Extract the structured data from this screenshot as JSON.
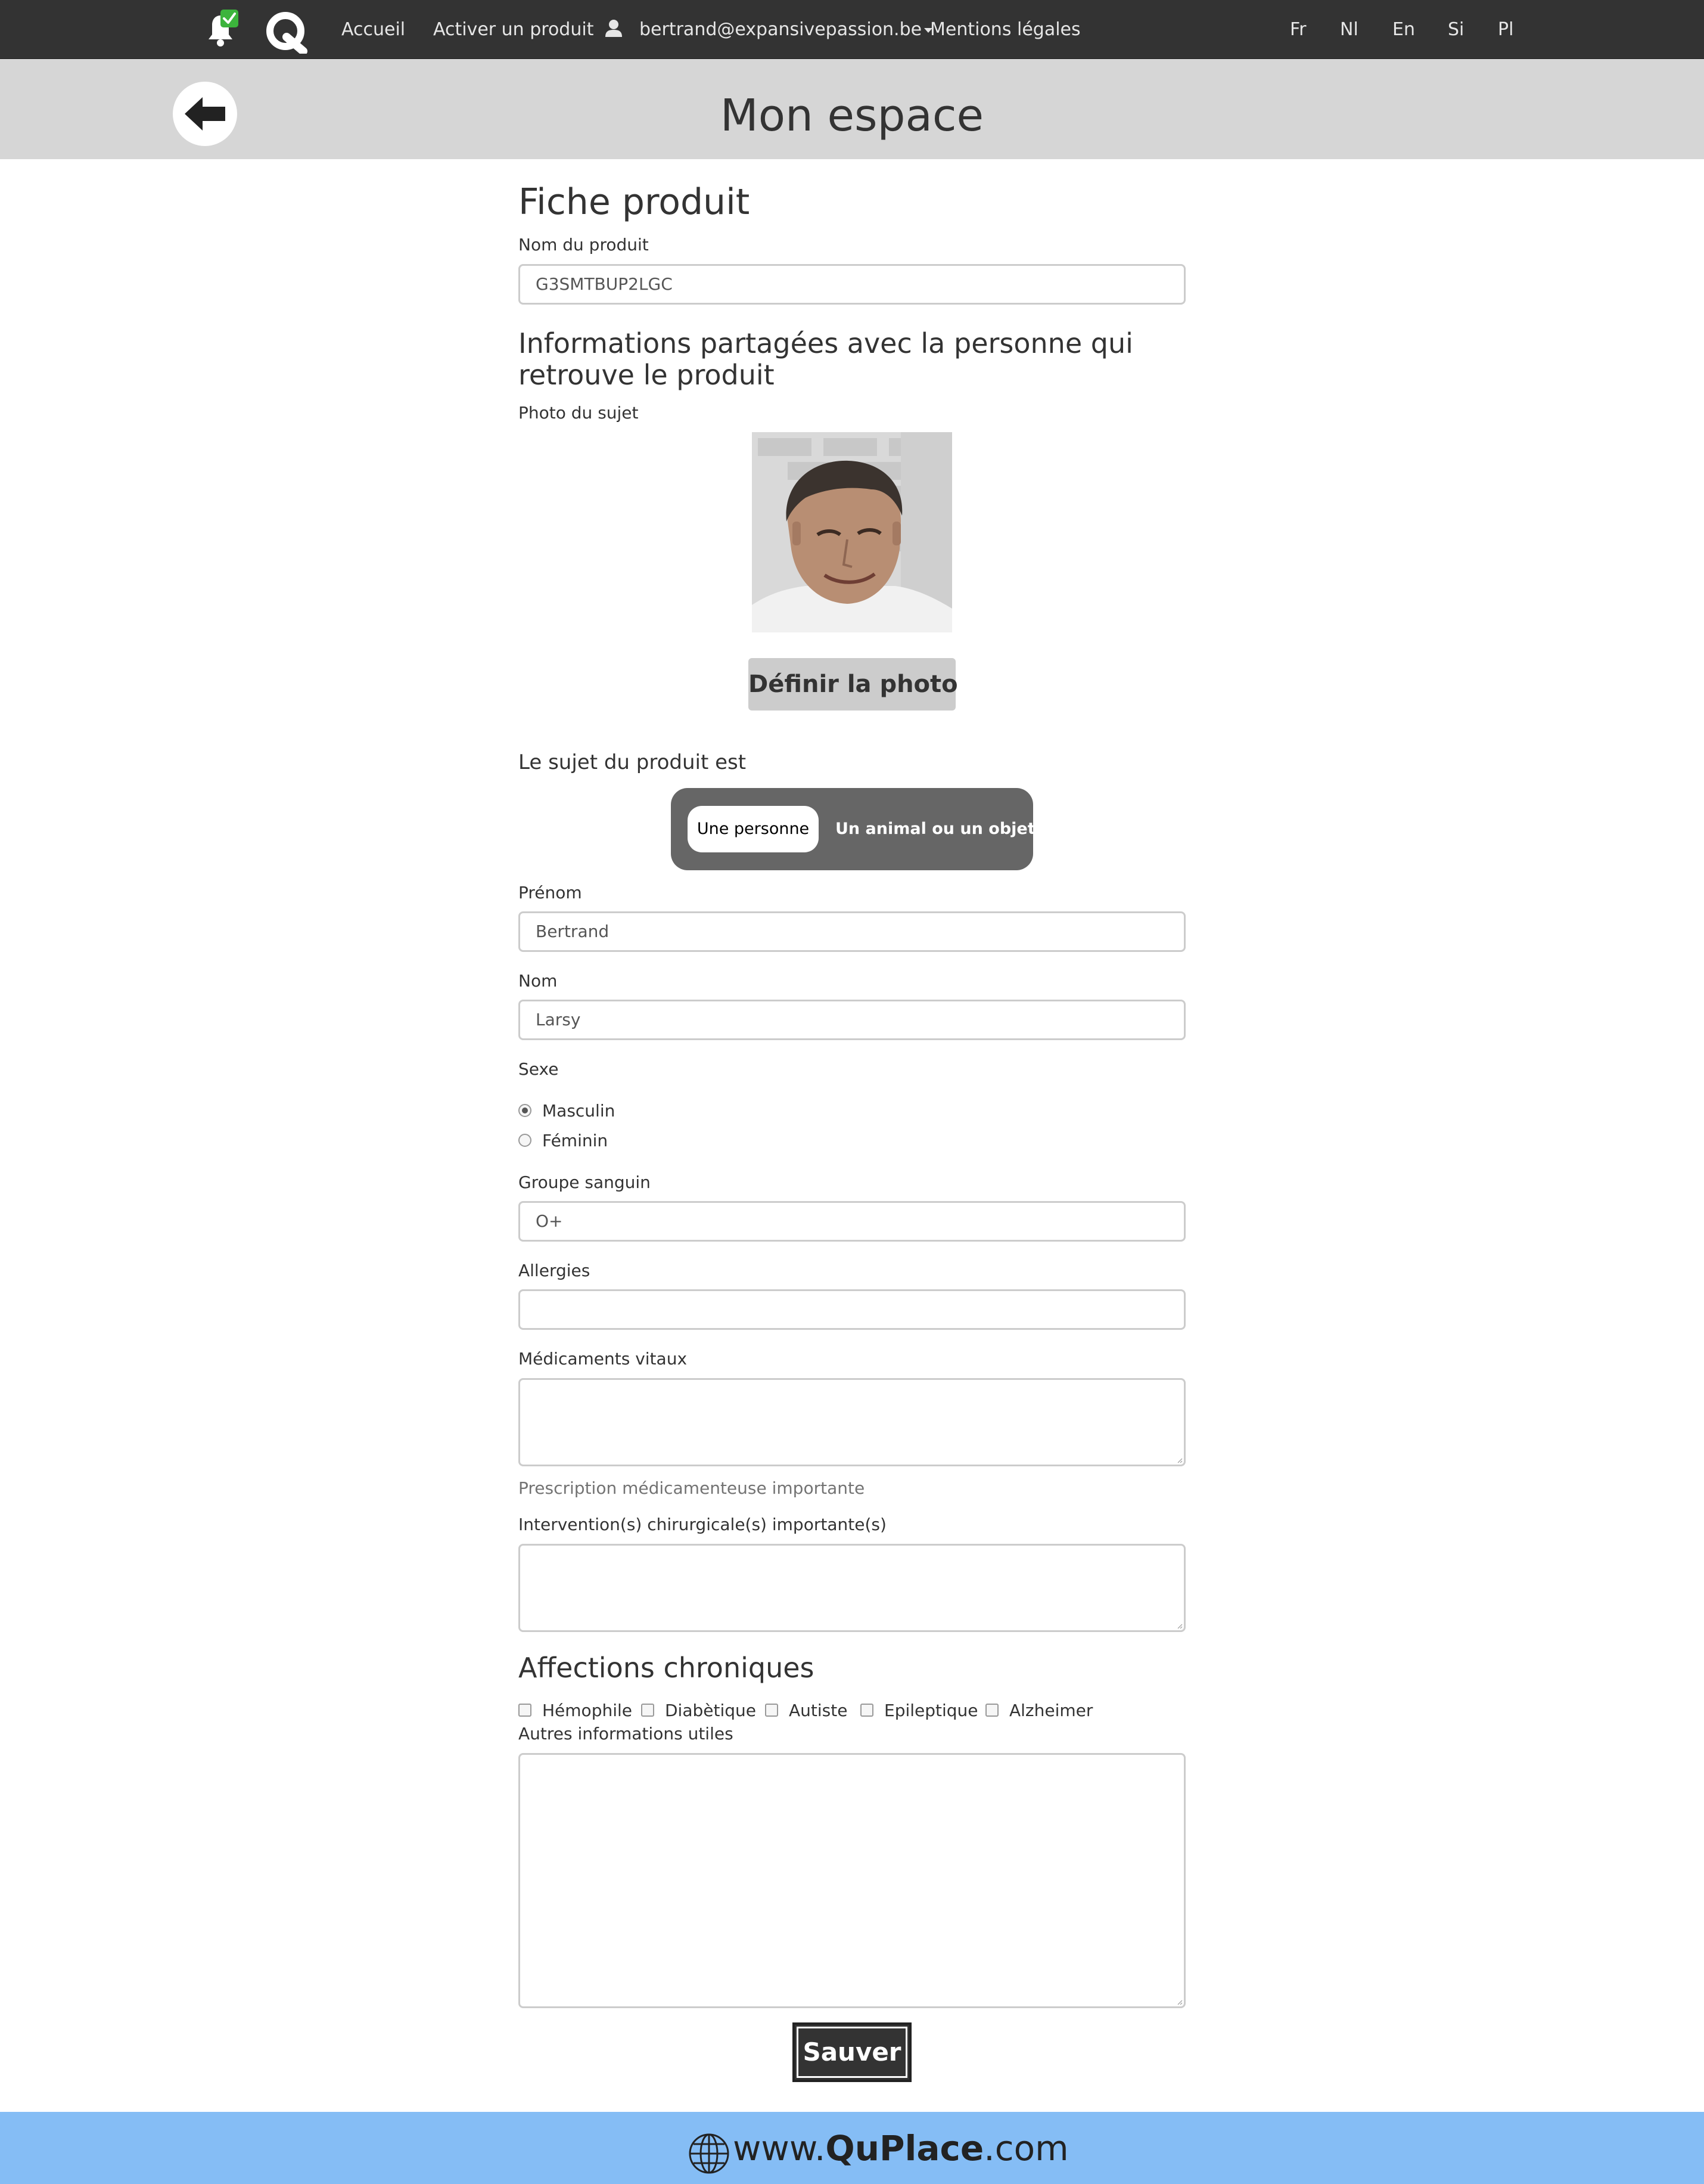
{
  "nav": {
    "home": "Accueil",
    "activate": "Activer un produit",
    "user": "bertrand@expansivepassion.be",
    "legal": "Mentions légales",
    "languages": [
      "Fr",
      "Nl",
      "En",
      "Si",
      "Pl"
    ]
  },
  "header": {
    "title": "Mon espace"
  },
  "form": {
    "heading": "Fiche produit",
    "product_name_label": "Nom du produit",
    "product_name_value": "G3SMTBUP2LGC",
    "shared_heading": "Informations partagées avec la personne qui retrouve le produit",
    "photo_label": "Photo du sujet",
    "photo_button": "Définir la photo",
    "subject_label": "Le sujet du produit est",
    "subject_options": [
      "Une personne",
      "Un animal ou un objet"
    ],
    "subject_selected": "Une personne",
    "firstname_label": "Prénom",
    "firstname_value": "Bertrand",
    "lastname_label": "Nom",
    "lastname_value": "Larsy",
    "sex_label": "Sexe",
    "sex_options": [
      "Masculin",
      "Féminin"
    ],
    "sex_selected": "Masculin",
    "blood_label": "Groupe sanguin",
    "blood_value": "O+",
    "allergies_label": "Allergies",
    "allergies_value": "",
    "meds_label": "Médicaments vitaux",
    "meds_help": "Prescription médicamenteuse importante",
    "surgery_label": "Intervention(s) chirurgicale(s) importante(s)",
    "chronic_heading": "Affections chroniques",
    "chronic_options": [
      "Hémophile",
      "Diabètique",
      "Autiste",
      "Epileptique",
      "Alzheimer"
    ],
    "other_label": "Autres informations utiles",
    "save_button": "Sauver"
  },
  "footer": {
    "prefix": "www.",
    "brand": "QuPlace",
    "suffix": ".com"
  },
  "colors": {
    "navbar": "#333333",
    "band": "#d6d6d6",
    "footer": "#85bdf5",
    "notification_check": "#3cb43c",
    "toggle_bg": "#666666"
  }
}
